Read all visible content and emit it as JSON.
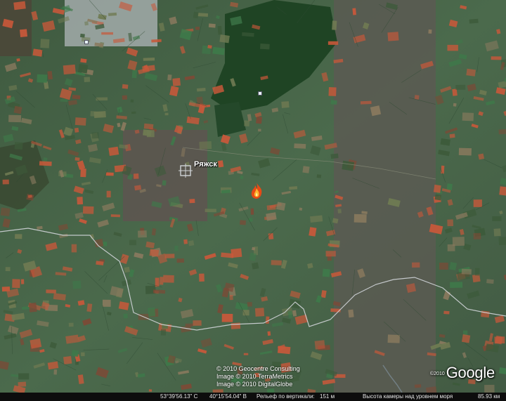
{
  "map": {
    "place_label": "Ряжск",
    "place_marker": "place-marker-icon",
    "fire_marker": "fire-icon"
  },
  "attribution": {
    "line1": "© 2010 Geocentre Consulting",
    "line2": "Image © 2010 TerraMetrics",
    "line3": "Image © 2010 DigitalGlobe"
  },
  "logo": {
    "year": "©2010",
    "text": "Google"
  },
  "status_bar": {
    "lat": "53°39'56.13\" С",
    "lon": "40°15'54.04\" В",
    "elevation_label": "Рельеф по вертикали:",
    "elevation_value": "151 м",
    "eye_alt_label": "Высота камеры над уровнем моря",
    "eye_alt_value": "85.93 км"
  },
  "colors": {
    "field_red": "#c8583a",
    "vegetation_green": "#3e7a4a",
    "forest_dark": "#1e3f22",
    "soil_brown": "#5e5448",
    "boundary_line": "#d0d4d8"
  }
}
